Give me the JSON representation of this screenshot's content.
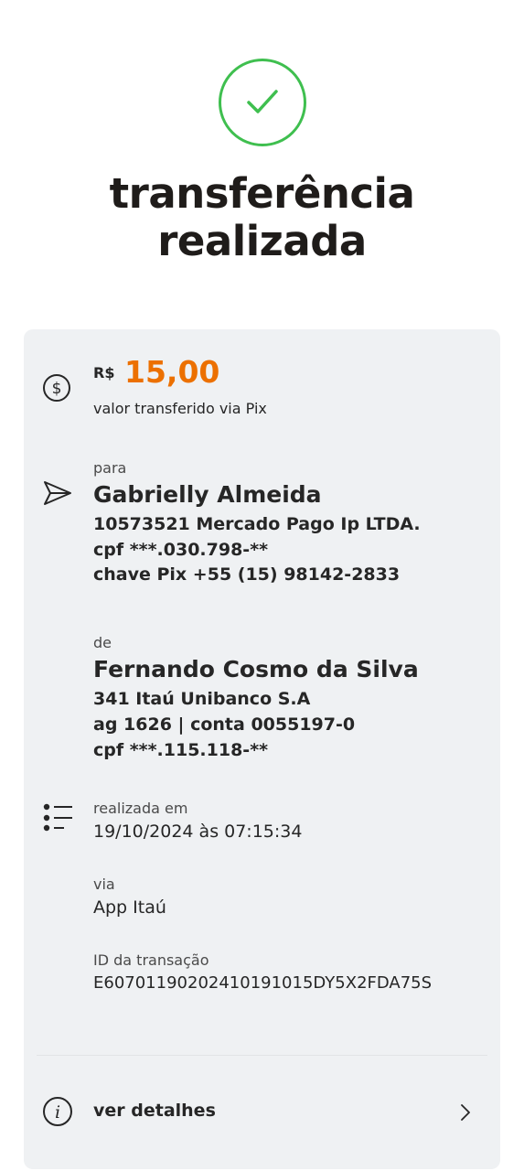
{
  "header": {
    "title_line1": "transferência",
    "title_line2": "realizada"
  },
  "icons": {
    "success": "check-circle-icon",
    "amount": "dollar-circle-icon",
    "recipient": "send-icon",
    "details": "list-icon",
    "info": "info-icon",
    "chevron": "chevron-right-icon"
  },
  "colors": {
    "success": "#3fbf4f",
    "amount": "#ec7000",
    "card_bg": "#eff1f3"
  },
  "amount": {
    "currency": "R$",
    "value": "15,00",
    "caption": "valor transferido via Pix"
  },
  "recipient": {
    "label": "para",
    "name": "Gabrielly Almeida",
    "bank": "10573521 Mercado Pago Ip LTDA.",
    "cpf": "cpf ***.030.798-**",
    "pix_key": "chave Pix +55 (15) 98142-2833"
  },
  "sender": {
    "label": "de",
    "name": "Fernando Cosmo da Silva",
    "bank": "341 Itaú Unibanco S.A",
    "account": "ag 1626 | conta 0055197-0",
    "cpf": "cpf ***.115.118-**"
  },
  "details": {
    "date_label": "realizada em",
    "date_value": "19/10/2024 às 07:15:34",
    "channel_label": "via",
    "channel_value": "App Itaú",
    "id_label": "ID da transação",
    "id_value": "E60701190202410191015DY5X2FDA75S"
  },
  "more": {
    "label": "ver detalhes"
  }
}
